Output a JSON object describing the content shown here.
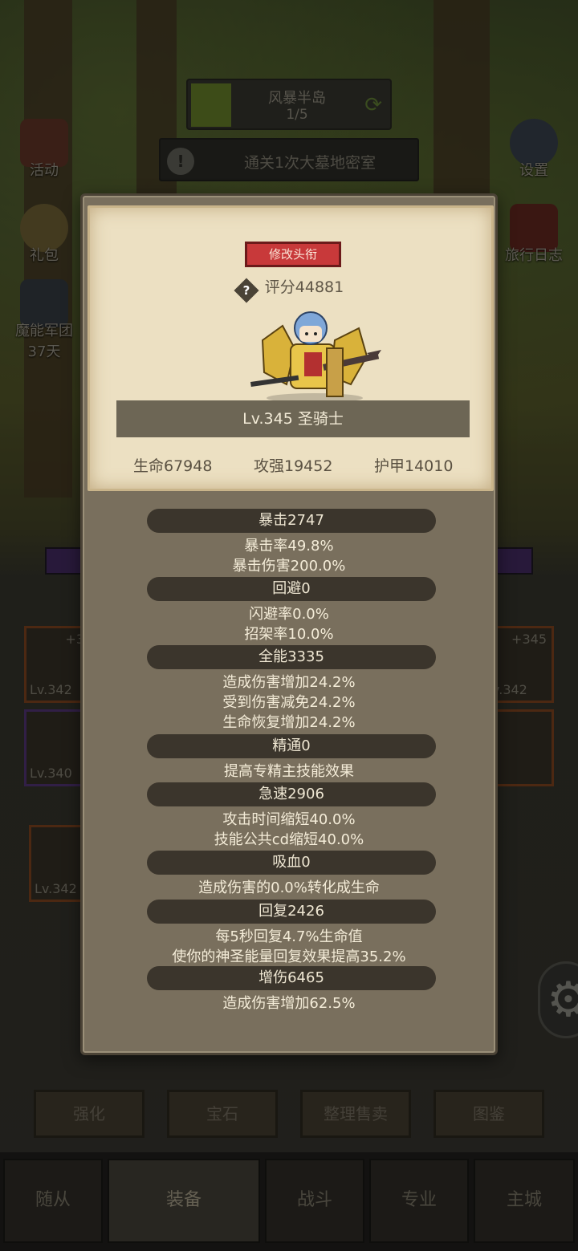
{
  "background": {
    "stage": {
      "name": "风暴半岛",
      "progress": "1/5"
    },
    "quest": {
      "text": "通关1次大墓地密室"
    },
    "left_menu": [
      {
        "label": "活动",
        "icon": "event-board-icon"
      },
      {
        "label": "礼包",
        "icon": "gift-helmet-icon"
      },
      {
        "label": "魔能军团",
        "sub": "37天",
        "icon": "demon-legion-icon"
      }
    ],
    "right_menu": [
      {
        "label": "设置",
        "icon": "gear-icon"
      },
      {
        "label": "旅行日志",
        "icon": "journal-icon"
      }
    ],
    "slots": {
      "top_left_plus": "+3",
      "top_left_lv": "Lv.342",
      "mid_left_lv": "Lv.340",
      "top_right_plus": "+345",
      "top_right_lv": "v.342",
      "lower_left_lv": "Lv.342"
    },
    "actions": [
      "强化",
      "宝石",
      "整理售卖",
      "图鉴"
    ],
    "tabs": [
      "随从",
      "装备",
      "战斗",
      "专业",
      "主城"
    ]
  },
  "popup": {
    "rename_label": "修改头衔",
    "score": "评分44881",
    "hero_name": "Lv.345 圣骑士",
    "main_stats": {
      "hp": "生命67948",
      "atk": "攻强19452",
      "armor": "护甲14010"
    },
    "groups": [
      {
        "title": "暴击2747",
        "lines": [
          "暴击率49.8%",
          "暴击伤害200.0%"
        ]
      },
      {
        "title": "回避0",
        "lines": [
          "闪避率0.0%",
          "招架率10.0%"
        ]
      },
      {
        "title": "全能3335",
        "lines": [
          "造成伤害增加24.2%",
          "受到伤害减免24.2%",
          "生命恢复增加24.2%"
        ]
      },
      {
        "title": "精通0",
        "lines": [
          "提高专精主技能效果"
        ]
      },
      {
        "title": "急速2906",
        "lines": [
          "攻击时间缩短40.0%",
          "技能公共cd缩短40.0%"
        ]
      },
      {
        "title": "吸血0",
        "lines": [
          "造成伤害的0.0%转化成生命"
        ]
      },
      {
        "title": "回复2426",
        "lines": [
          "每5秒回复4.7%生命值",
          "使你的神圣能量回复效果提高35.2%"
        ]
      },
      {
        "title": "增伤6465",
        "lines": [
          "造成伤害增加62.5%"
        ]
      }
    ]
  }
}
